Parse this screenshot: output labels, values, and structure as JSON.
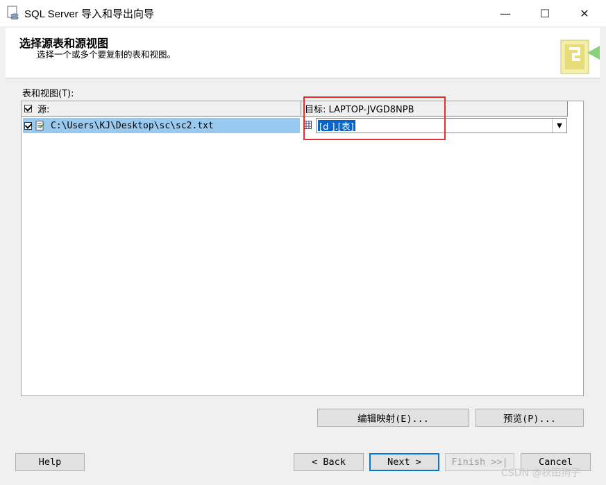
{
  "window": {
    "title": "SQL Server 导入和导出向导",
    "minimize": "—",
    "maximize": "☐",
    "close": "✕"
  },
  "header": {
    "title": "选择源表和源视图",
    "subtitle": "选择一个或多个要复制的表和视图。"
  },
  "tables_label": "表和视图(T):",
  "grid": {
    "columns": {
      "source": "源:",
      "destination": "目标: LAPTOP-JVGD8NPB"
    },
    "rows": [
      {
        "checked": true,
        "source": "C:\\Users\\KJ\\Desktop\\sc\\sc2.txt",
        "destination": "[d        ].[表]"
      }
    ]
  },
  "buttons": {
    "edit_mappings": "编辑映射(E)...",
    "preview": "预览(P)...",
    "help": "Help",
    "back": "< Back",
    "next": "Next >",
    "finish": "Finish >>|",
    "cancel": "Cancel"
  },
  "watermark": "CSDN @秋田狗子",
  "colors": {
    "selection": "#0a64c8",
    "row_highlight": "#99c9ef",
    "annotation": "#e03030"
  }
}
